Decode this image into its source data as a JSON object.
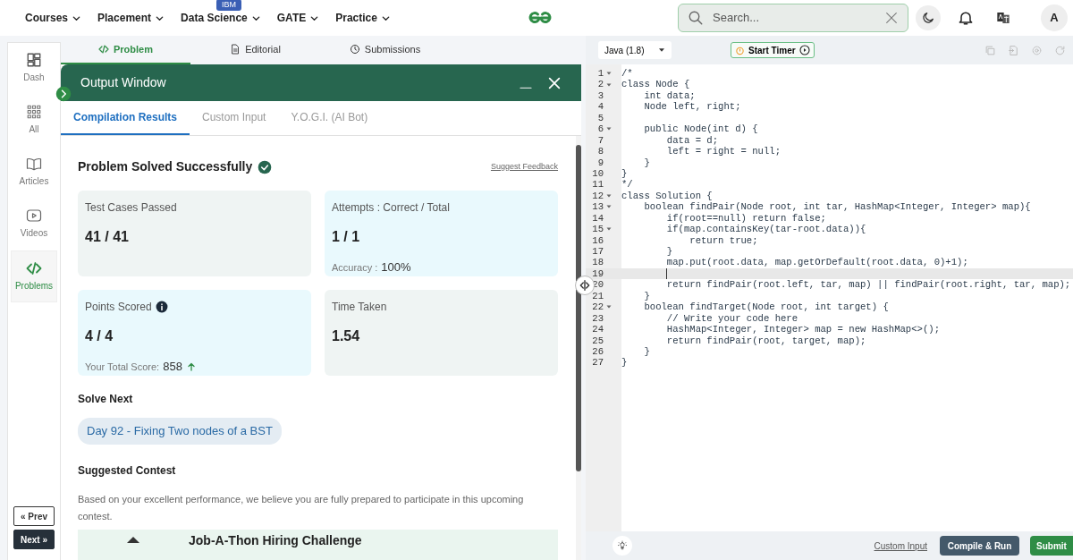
{
  "nav": {
    "menus": [
      {
        "label": "Courses"
      },
      {
        "label": "Placement"
      },
      {
        "label": "Data Science",
        "badge": "IBM"
      },
      {
        "label": "GATE"
      },
      {
        "label": "Practice"
      }
    ],
    "search": {
      "placeholder": "Search..."
    },
    "avatar": "A"
  },
  "sidebar": {
    "items": [
      {
        "label": "Dash",
        "kind": "dash",
        "selected": false
      },
      {
        "label": "All",
        "kind": "grid",
        "selected": false
      },
      {
        "label": "Articles",
        "kind": "book",
        "selected": false
      },
      {
        "label": "Videos",
        "kind": "video",
        "selected": false
      },
      {
        "label": "Problems",
        "kind": "code",
        "selected": true
      }
    ],
    "prev": "« Prev",
    "next": "Next »"
  },
  "problem_tabs": [
    {
      "label": "Problem",
      "kind": "code",
      "selected": true
    },
    {
      "label": "Editorial",
      "kind": "doc",
      "selected": false
    },
    {
      "label": "Submissions",
      "kind": "clock",
      "selected": false
    }
  ],
  "output_window": {
    "title": "Output Window",
    "tabs": [
      {
        "label": "Compilation Results",
        "selected": true
      },
      {
        "label": "Custom Input",
        "selected": false
      },
      {
        "label": "Y.O.G.I. (AI Bot)",
        "selected": false
      }
    ],
    "status": "Problem Solved Successfully",
    "feedback": "Suggest Feedback",
    "stats": [
      {
        "label": "Test Cases Passed",
        "value": "41 / 41",
        "color": "#eff4f3"
      },
      {
        "label": "Attempts : Correct / Total",
        "value": "1 / 1",
        "note_label": "Accuracy :",
        "note_value": "100%",
        "color": "#e9f9fd"
      },
      {
        "label": "Points Scored",
        "info": true,
        "value": "4 / 4",
        "note_label": "Your Total Score:",
        "note_value": "858",
        "rising": true,
        "color": "#e9f9fd"
      },
      {
        "label": "Time Taken",
        "value": "1.54",
        "color": "#eff4f3"
      }
    ],
    "solve_next": {
      "heading": "Solve Next",
      "link": "Day 92 - Fixing Two nodes of a BST"
    },
    "contest": {
      "heading": "Suggested Contest",
      "text": "Based on your excellent performance, we believe you are fully prepared to participate in this upcoming contest.",
      "card_title": "Job-A-Thon Hiring Challenge"
    }
  },
  "editor": {
    "language": "Java (1.8)",
    "timer": "Start Timer",
    "lines": [
      {
        "num": "1",
        "text": "/*",
        "foldable": true,
        "current": false
      },
      {
        "num": "2",
        "text": "class Node {",
        "foldable": true,
        "current": false
      },
      {
        "num": "3",
        "text": "    int data;",
        "foldable": false,
        "current": false
      },
      {
        "num": "4",
        "text": "    Node left, right;",
        "foldable": false,
        "current": false
      },
      {
        "num": "5",
        "foldable": false,
        "current": false
      },
      {
        "num": "6",
        "text": "    public Node(int d) {",
        "foldable": true,
        "current": false
      },
      {
        "num": "7",
        "text": "        data = d;",
        "foldable": false,
        "current": false
      },
      {
        "num": "8",
        "text": "        left = right = null;",
        "foldable": false,
        "current": false
      },
      {
        "num": "9",
        "text": "    }",
        "foldable": false,
        "current": false
      },
      {
        "num": "10",
        "text": "}",
        "foldable": false,
        "current": false
      },
      {
        "num": "11",
        "text": "*/",
        "foldable": false,
        "current": false
      },
      {
        "num": "12",
        "text": "class Solution {",
        "foldable": true,
        "current": false
      },
      {
        "num": "13",
        "text": "    boolean findPair(Node root, int tar, HashMap<Integer, Integer> map){",
        "foldable": true,
        "current": false
      },
      {
        "num": "14",
        "text": "        if(root==null) return false;",
        "foldable": false,
        "current": false
      },
      {
        "num": "15",
        "text": "        if(map.containsKey(tar-root.data)){",
        "foldable": true,
        "current": false
      },
      {
        "num": "16",
        "text": "            return true;",
        "foldable": false,
        "current": false
      },
      {
        "num": "17",
        "text": "        }",
        "foldable": false,
        "current": false
      },
      {
        "num": "18",
        "text": "        map.put(root.data, map.getOrDefault(root.data, 0)+1);",
        "foldable": false,
        "current": false
      },
      {
        "num": "19",
        "foldable": false,
        "current": true
      },
      {
        "num": "20",
        "text": "        return findPair(root.left, tar, map) || findPair(root.right, tar, map);",
        "foldable": false,
        "current": false
      },
      {
        "num": "21",
        "text": "    }",
        "foldable": false,
        "current": false
      },
      {
        "num": "22",
        "text": "    boolean findTarget(Node root, int target) {",
        "foldable": true,
        "current": false
      },
      {
        "num": "23",
        "text": "        // Write your code here",
        "foldable": false,
        "current": false
      },
      {
        "num": "24",
        "text": "        HashMap<Integer, Integer> map = new HashMap<>();",
        "foldable": false,
        "current": false
      },
      {
        "num": "25",
        "text": "        return findPair(root, target, map);",
        "foldable": false,
        "current": false
      },
      {
        "num": "26",
        "text": "    }",
        "foldable": false,
        "current": false
      },
      {
        "num": "27",
        "text": "}",
        "foldable": false,
        "current": false
      }
    ],
    "custom_input": "Custom Input",
    "compile": "Compile & Run",
    "submit": "Submit"
  }
}
